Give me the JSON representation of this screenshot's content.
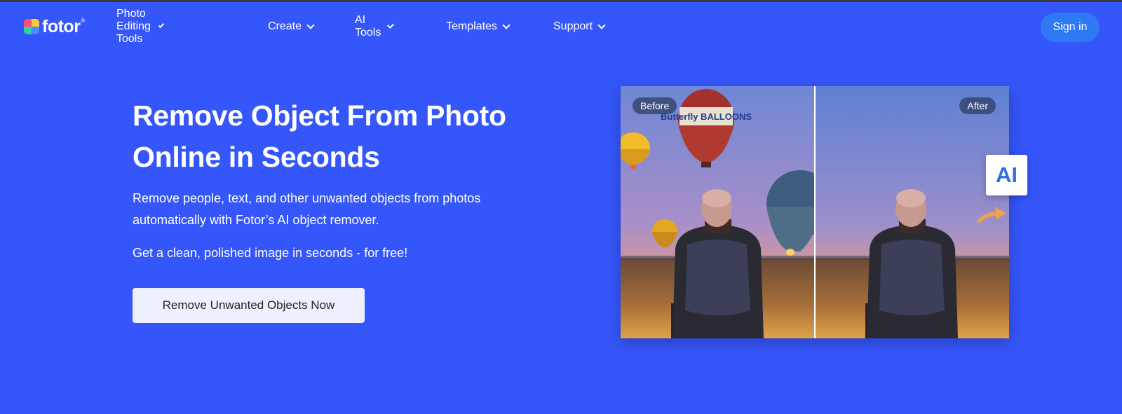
{
  "brand": {
    "name": "fotor",
    "reg": "®"
  },
  "nav": [
    {
      "label": "Photo Editing Tools"
    },
    {
      "label": "Create"
    },
    {
      "label": "AI Tools"
    },
    {
      "label": "Templates"
    },
    {
      "label": "Support"
    }
  ],
  "header": {
    "signin_label": "Sign in"
  },
  "hero": {
    "title": "Remove Object From Photo Online in Seconds",
    "description": "Remove people, text, and other unwanted objects from photos automatically with Fotor’s AI object remover.",
    "subtext": "Get a clean, polished image in seconds - for free!",
    "cta_label": "Remove Unwanted Objects Now"
  },
  "comparison": {
    "before_label": "Before",
    "after_label": "After",
    "ai_badge": "AI",
    "balloon_text": "Butterfly BALLOONS"
  },
  "colors": {
    "background": "#3556fb",
    "signin_bg": "#2f79f5",
    "cta_bg": "#eef0ff",
    "ai_text": "#2d6ee6",
    "arrow": "#f0a050"
  }
}
